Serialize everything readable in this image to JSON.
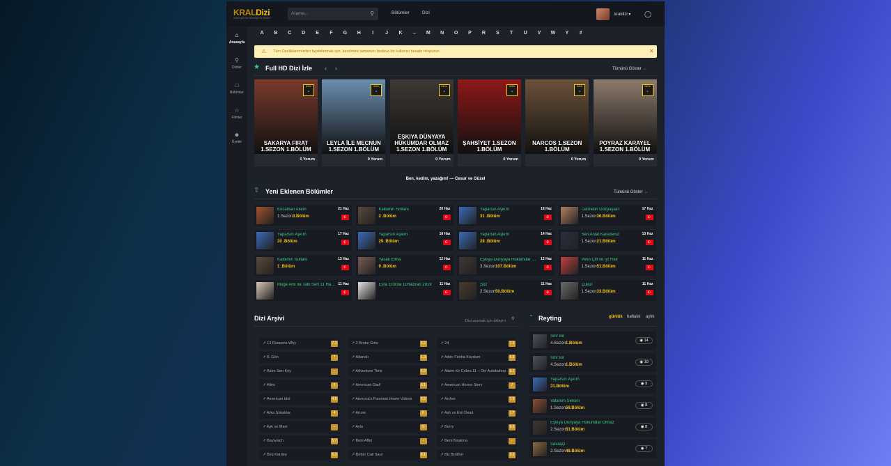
{
  "header": {
    "logo": "KRAL",
    "logo_accent": "Dizi",
    "logo_tagline": "Kralın gibi dizi izlemeye ne dersin?",
    "search_placeholder": "Arama...",
    "nav": [
      "Bölümler",
      "Dizi"
    ],
    "username": "kraldizi"
  },
  "sidebar": [
    {
      "label": "Anasayfa",
      "icon": "home-icon"
    },
    {
      "label": "Diziler",
      "icon": "search-icon"
    },
    {
      "label": "Bölümler",
      "icon": "square-icon"
    },
    {
      "label": "Filmler",
      "icon": "star-icon"
    },
    {
      "label": "Üyeler",
      "icon": "users-icon"
    }
  ],
  "alphabet": [
    "A",
    "B",
    "C",
    "D",
    "E",
    "F",
    "G",
    "H",
    "I",
    "J",
    "K",
    "..",
    "M",
    "N",
    "O",
    "P",
    "R",
    "S",
    "T",
    "U",
    "V",
    "W",
    "Y",
    "#"
  ],
  "notice": {
    "text": "Tüm Özelliklerimizden faydalanmak için, kendinize tamamen bedava bir kullanıcı hesabı oluşturun."
  },
  "fullhd": {
    "title": "Full HD Dizi İzle",
    "show_all": "Tümünü Göster",
    "posters": [
      {
        "overlay": "SAKARYA FIRAT 1.SEZON 1.BÖLÜM",
        "rating": "-",
        "comments": "0 Yorum",
        "imdb": "IMDb",
        "color": "#7a3a2c"
      },
      {
        "overlay": "LEYLA İLE MECNUN 1.SEZON 1.BÖLÜM",
        "rating": "-",
        "comments": "0 Yorum",
        "imdb": "IMDb",
        "color": "#6a8fb0"
      },
      {
        "overlay": "EŞKIYA DÜNYAYA HÜKÜMDAR OLMAZ 1.SEZON 1.BÖLÜM",
        "rating": "-",
        "comments": "0 Yorum",
        "imdb": "IMDb",
        "color": "#3d3833"
      },
      {
        "overlay": "ŞAHSİYET 1.SEZON 1.BÖLÜM",
        "rating": "-",
        "comments": "0 Yorum",
        "imdb": "IMDb",
        "color": "#8e1818"
      },
      {
        "overlay": "NARCOS 1.SEZON 1.BÖLÜM",
        "rating": "-",
        "comments": "0 Yorum",
        "imdb": "IMDb",
        "color": "#6b5238"
      },
      {
        "overlay": "POYRAZ KARAYEL 1.SEZON 1.BÖLÜM",
        "rating": "-",
        "comments": "0 Yorum",
        "imdb": "IMDb",
        "color": "#8c7a6b"
      }
    ]
  },
  "tagline": "Ben, kedim, yazağım! — Cesur ve Güzel",
  "new_episodes": {
    "title": "Yeni Eklenen Bölümler",
    "show_all": "Tümünü Göster",
    "items": [
      {
        "name": "Kocaman Ailem",
        "season": "1.Sezon",
        "episode": "3.Bölüm",
        "date": "21 Haz",
        "color": "#a0522d"
      },
      {
        "name": "Kalbimin Sultanı",
        "season": "",
        "episode": "2 .Bölüm",
        "date": "20 Haz",
        "color": "#5a4a3a"
      },
      {
        "name": "Yaparsın Aşkım",
        "season": "",
        "episode": "31 .Bölüm",
        "date": "18 Haz",
        "color": "#3a6ab8"
      },
      {
        "name": "Cennetin Gözyaşları",
        "season": "1.Sezon",
        "episode": "36.Bölüm",
        "date": "17 Haz",
        "color": "#b08060"
      },
      {
        "name": "Yaparsın Aşkım",
        "season": "",
        "episode": "30 .Bölüm",
        "date": "17 Haz",
        "color": "#3a6ab8"
      },
      {
        "name": "Yaparsın Aşkım",
        "season": "",
        "episode": "29 .Bölüm",
        "date": "16 Haz",
        "color": "#3a6ab8"
      },
      {
        "name": "Yaparsın Aşkım",
        "season": "",
        "episode": "28 .Bölüm",
        "date": "14 Haz",
        "color": "#3a6ab8"
      },
      {
        "name": "Sen Anlat Karadeniz",
        "season": "1.Sezon",
        "episode": "21.Bölüm",
        "date": "13 Haz",
        "color": "#2a3040"
      },
      {
        "name": "Kalbimin Sultanı",
        "season": "",
        "episode": "1 .Bölüm",
        "date": "13 Haz",
        "color": "#5a4a3a"
      },
      {
        "name": "Yasak Elma",
        "season": "",
        "episode": "9 .Bölüm",
        "date": "12 Haz",
        "color": "#7a5a50"
      },
      {
        "name": "Eşkıya Dünyaya Hükümdar Olmaz",
        "season": "3.Sezon",
        "episode": "107.Bölüm",
        "date": "12 Haz",
        "color": "#3d3833"
      },
      {
        "name": "Pelin Çift ile İyi Fikir",
        "season": "1.Sezon",
        "episode": "51.Bölüm",
        "date": "11 Haz",
        "color": "#c04040"
      },
      {
        "name": "Müge Anlı İle Tatlı Sert 11 Haziran",
        "season": "",
        "episode": "",
        "date": "11 Haz",
        "color": "#d8c8b8"
      },
      {
        "name": "Esra Erol'da 11Haziran 2019",
        "season": "",
        "episode": "",
        "date": "11 Haz",
        "color": "#e8e0e0"
      },
      {
        "name": "Söz",
        "season": "2.Sezon",
        "episode": "50.Bölüm",
        "date": "11 Haz",
        "color": "#4a3a30"
      },
      {
        "name": "Çukur",
        "season": "1.Sezon",
        "episode": "33.Bölüm",
        "date": "11 Haz",
        "color": "#6a6a6a"
      }
    ]
  },
  "archive": {
    "title": "Dizi Arşivi",
    "search_placeholder": "Dizi aramak için tıklayın",
    "items": [
      {
        "name": "13 Reasons Why",
        "rating": "7.3"
      },
      {
        "name": "2 Broke Girls",
        "rating": "5.5"
      },
      {
        "name": "24",
        "rating": "7.6"
      },
      {
        "name": "8. Gün",
        "rating": "7"
      },
      {
        "name": "Adanalı",
        "rating": "1.3"
      },
      {
        "name": "Adını Feriha Koydum",
        "rating": "6.5"
      },
      {
        "name": "Adını Sen Koy",
        "rating": "-"
      },
      {
        "name": "Adventure Time",
        "rating": "6.9"
      },
      {
        "name": "Alarm für Cobra 11 – Die Autobahnpolizei",
        "rating": "5.1"
      },
      {
        "name": "Alles",
        "rating": "6"
      },
      {
        "name": "American Dad!",
        "rating": "6.1"
      },
      {
        "name": "American Horror Story",
        "rating": "7"
      },
      {
        "name": "American Idol",
        "rating": "4.5"
      },
      {
        "name": "America's Funniest Home Videos",
        "rating": "5.5"
      },
      {
        "name": "Archer",
        "rating": "7.9"
      },
      {
        "name": "Arka Sokaklar",
        "rating": "4"
      },
      {
        "name": "Arrow",
        "rating": "6"
      },
      {
        "name": "Ash vs Evil Dead",
        "rating": "7.7"
      },
      {
        "name": "Aşk ve Mavi",
        "rating": "-"
      },
      {
        "name": "Avlu",
        "rating": "6"
      },
      {
        "name": "Berry",
        "rating": "6.5"
      },
      {
        "name": "Baywatch",
        "rating": "5.7"
      },
      {
        "name": "Beni Affet",
        "rating": "-"
      },
      {
        "name": "Beni Bırakma",
        "rating": "-"
      },
      {
        "name": "Beş Kardeş",
        "rating": "5.3"
      },
      {
        "name": "Better Call Saul",
        "rating": "8.1"
      },
      {
        "name": "Biz Brother",
        "rating": "2.3"
      }
    ]
  },
  "rating_panel": {
    "title": "Reyting",
    "tabs": [
      "günlük",
      "haftalık",
      "aylık"
    ],
    "items": [
      {
        "name": "Sıfır Bir",
        "season": "4.Sezon",
        "episode": "1.Bölüm",
        "views": "14",
        "color": "#4a5060"
      },
      {
        "name": "Sıfır Bir",
        "season": "4.Sezon",
        "episode": "1.Bölüm",
        "views": "10",
        "color": "#4a5060"
      },
      {
        "name": "Yaparsın Aşkım",
        "season": "",
        "episode": "31.Bölüm",
        "views": "9",
        "color": "#3a6ab8"
      },
      {
        "name": "Vatanım Sensin",
        "season": "1.Sezon",
        "episode": "58.Bölüm",
        "views": "8",
        "color": "#8a5030"
      },
      {
        "name": "Eşkıya Dünyaya Hükümdar Olmaz",
        "season": "2.Sezon",
        "episode": "51.Bölüm",
        "views": "8",
        "color": "#3d3833"
      },
      {
        "name": "Savaşçı",
        "season": "2.Sezon",
        "episode": "48.Bölüm",
        "views": "7",
        "color": "#8a6a40"
      }
    ]
  }
}
